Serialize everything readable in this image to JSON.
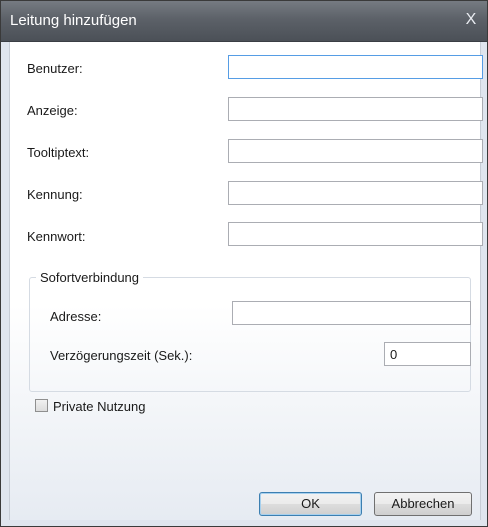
{
  "dialog": {
    "title": "Leitung hinzufügen",
    "close_glyph": "X"
  },
  "form": {
    "fields": [
      {
        "label": "Benutzer:",
        "value": ""
      },
      {
        "label": "Anzeige:",
        "value": ""
      },
      {
        "label": "Tooltiptext:",
        "value": ""
      },
      {
        "label": "Kennung:",
        "value": ""
      },
      {
        "label": "Kennwort:",
        "value": ""
      }
    ]
  },
  "instant_connection": {
    "legend": "Sofortverbindung",
    "address_label": "Adresse:",
    "address_value": "",
    "delay_label": "Verzögerungszeit (Sek.):",
    "delay_value": "0"
  },
  "private_use": {
    "label": "Private Nutzung",
    "checked": false
  },
  "buttons": {
    "ok": "OK",
    "cancel": "Abbrechen"
  },
  "icons": {
    "close": "close-icon",
    "checkbox": "checkbox-unchecked"
  },
  "colors": {
    "titlebar": "#5c6168",
    "focus_border": "#569de5",
    "default_button_border": "#3c7fb1"
  }
}
